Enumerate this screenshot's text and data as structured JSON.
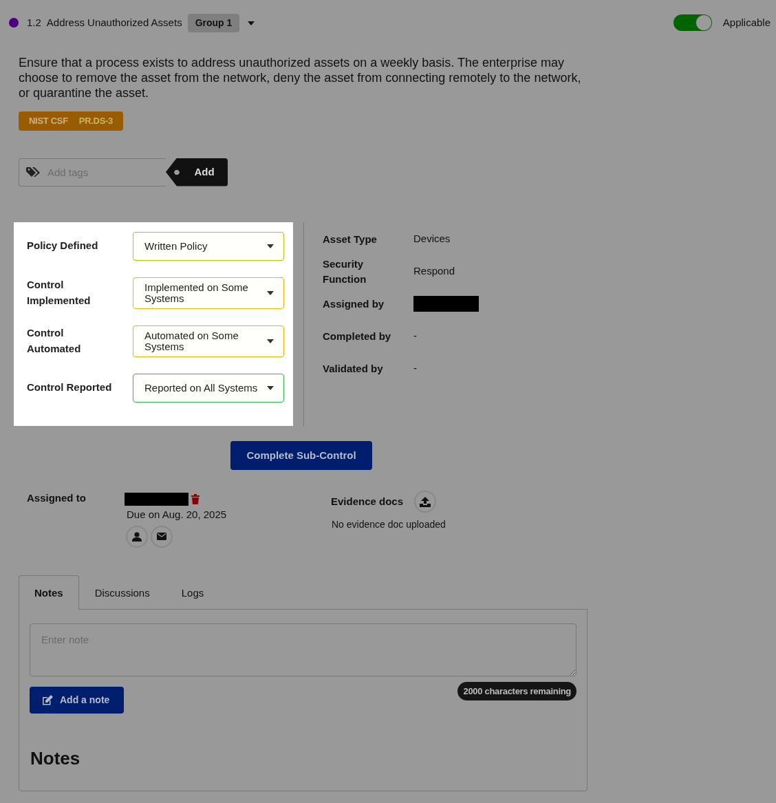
{
  "header": {
    "status_dot": {
      "color": "#4b0082"
    },
    "number": "1.2",
    "title": "Address Unauthorized Assets",
    "group": "Group 1",
    "applicable": {
      "label": "Applicable",
      "on": true
    }
  },
  "description": "Ensure that a process exists to address unauthorized assets on a weekly basis. The enterprise may choose to remove the asset from the network, deny the asset from connecting remotely to the network, or quarantine the asset.",
  "framework_tag": {
    "framework": "NIST CSF",
    "code": "PR.DS-3"
  },
  "tags_input": {
    "placeholder": "Add tags",
    "button": "Add"
  },
  "maturity": [
    {
      "label": "Policy Defined",
      "value": "Written Policy",
      "color": "#b5c800"
    },
    {
      "label": "Control Implemented",
      "value": "Implemented on Some Systems",
      "color": "#f0b800"
    },
    {
      "label": "Control Automated",
      "value": "Automated on Some Systems",
      "color": "#f0b800"
    },
    {
      "label": "Control Reported",
      "value": "Reported on All Systems",
      "color": "#2db84a"
    }
  ],
  "details": [
    {
      "label": "Asset Type",
      "kind": "text",
      "value": "Devices"
    },
    {
      "label": "Security Function",
      "kind": "text",
      "value": "Respond"
    },
    {
      "label": "Assigned by",
      "kind": "redacted"
    },
    {
      "label": "Completed by",
      "kind": "text",
      "value": "-"
    },
    {
      "label": "Validated by",
      "kind": "text",
      "value": "-"
    }
  ],
  "complete_button": "Complete Sub-Control",
  "assignment": {
    "label": "Assigned to",
    "assignee": {
      "kind": "redacted"
    },
    "due": "Due on Aug. 20, 2025"
  },
  "evidence": {
    "label": "Evidence docs",
    "empty_text": "No evidence doc uploaded"
  },
  "tabs": [
    {
      "label": "Notes",
      "selected": true
    },
    {
      "label": "Discussions",
      "selected": false
    },
    {
      "label": "Logs",
      "selected": false
    }
  ],
  "note_field": {
    "placeholder": "Enter note"
  },
  "add_note_button": "Add a note",
  "char_counter": "2000 characters remaining",
  "notes_heading": "Notes"
}
